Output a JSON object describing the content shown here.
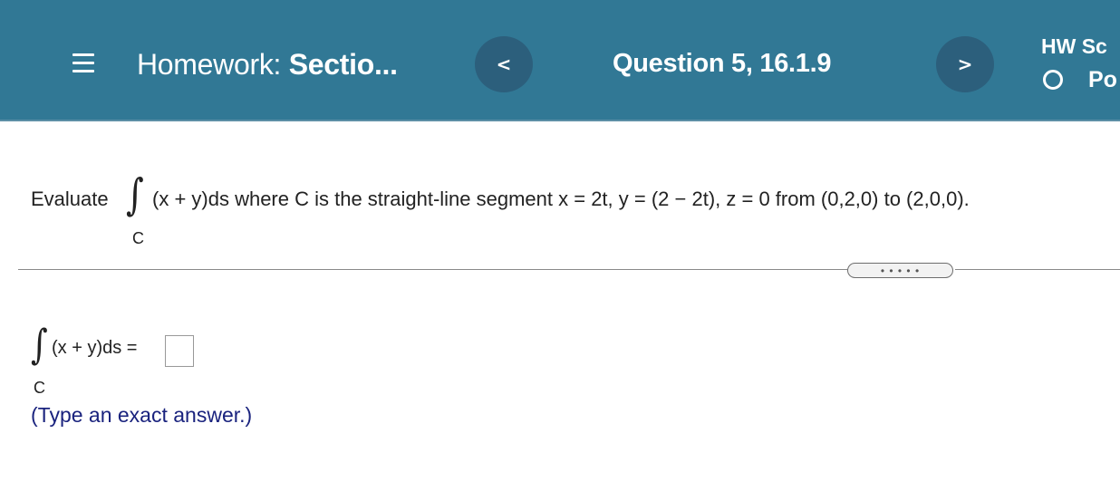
{
  "header": {
    "menu_icon": "hamburger-menu-icon",
    "title_prefix": "Homework:",
    "title_bold": "Sectio...",
    "prev_label": "<",
    "question_label": "Question 5, 16.1.9",
    "next_label": ">",
    "score_label": "HW Sc",
    "points_label": "Po"
  },
  "question": {
    "lead": "Evaluate",
    "integral_symbol": "∫",
    "integral_sub": "C",
    "expression": "(x + y)ds where C is the straight-line segment x = 2t,  y = (2 − 2t),  z = 0 from (0,2,0) to (2,0,0)."
  },
  "more_button": "• • • • •",
  "answer": {
    "integral_symbol": "∫",
    "integral_sub": "C",
    "expression": "(x + y)ds =",
    "value": "",
    "hint": "(Type an exact answer.)"
  },
  "colors": {
    "header_bg": "#317895",
    "nav_button_bg": "#2c5f7c",
    "hint_text": "#1a237e"
  }
}
